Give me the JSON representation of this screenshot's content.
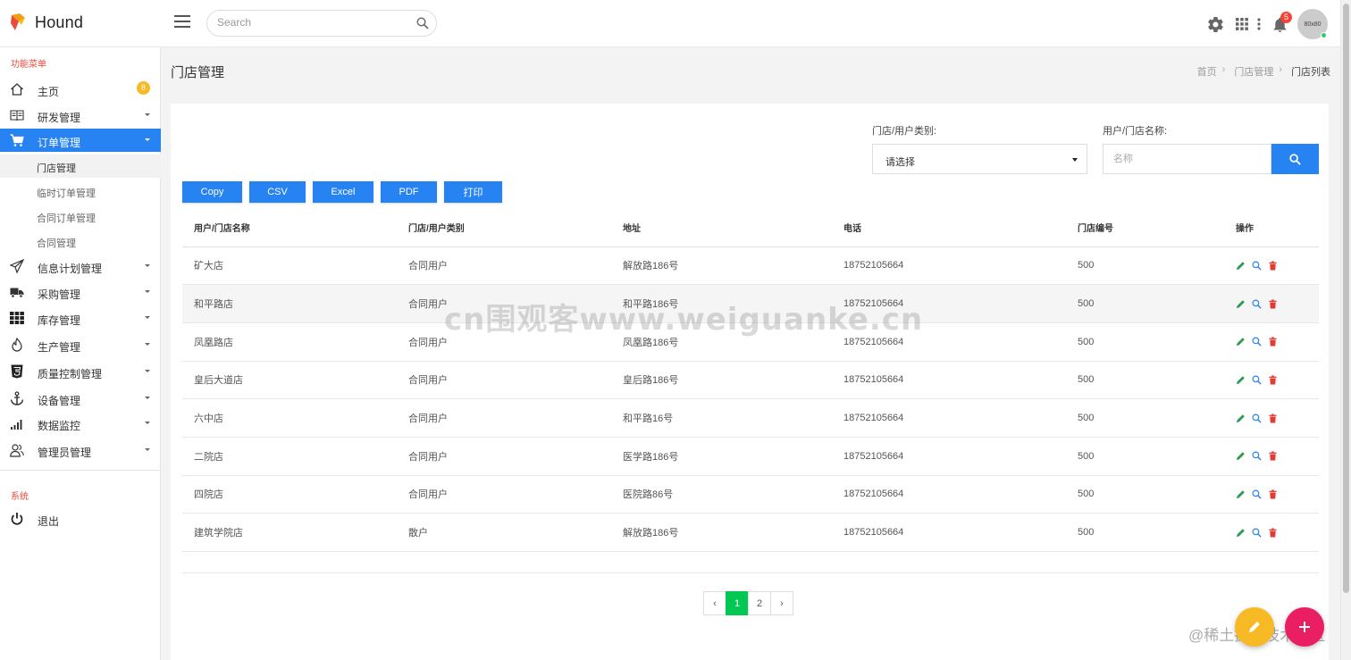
{
  "brand": {
    "name": "Hound"
  },
  "search": {
    "placeholder": "Search"
  },
  "topbar": {
    "notification_count": "5",
    "avatar_text": "80x80"
  },
  "sidebar": {
    "section_functions": "功能菜单",
    "items": [
      {
        "label": "主页",
        "icon": "home-icon",
        "badge": "8"
      },
      {
        "label": "研发管理",
        "icon": "book-icon"
      },
      {
        "label": "订单管理",
        "icon": "cart-icon",
        "active": true
      },
      {
        "label": "信息计划管理",
        "icon": "send-icon"
      },
      {
        "label": "采购管理",
        "icon": "truck-icon"
      },
      {
        "label": "库存管理",
        "icon": "grid-icon"
      },
      {
        "label": "生产管理",
        "icon": "flame-icon"
      },
      {
        "label": "质量控制管理",
        "icon": "html5-icon"
      },
      {
        "label": "设备管理",
        "icon": "anchor-icon"
      },
      {
        "label": "数据监控",
        "icon": "signal-icon"
      },
      {
        "label": "管理员管理",
        "icon": "users-icon"
      }
    ],
    "sub_items": [
      "门店管理",
      "临时订单管理",
      "合同订单管理",
      "合同管理"
    ],
    "section_system": "系统",
    "logout": "退出"
  },
  "page": {
    "title": "门店管理",
    "breadcrumb": [
      "首页",
      "门店管理",
      "门店列表"
    ]
  },
  "filters": {
    "type_label": "门店/用户类别:",
    "type_value": "请选择",
    "name_label": "用户/门店名称:",
    "name_placeholder": "名称"
  },
  "export_buttons": [
    "Copy",
    "CSV",
    "Excel",
    "PDF",
    "打印"
  ],
  "table": {
    "columns": [
      "用户/门店名称",
      "门店/用户类别",
      "地址",
      "电话",
      "门店编号",
      "操作"
    ],
    "rows": [
      [
        "矿大店",
        "合同用户",
        "解放路186号",
        "18752105664",
        "500"
      ],
      [
        "和平路店",
        "合同用户",
        "和平路186号",
        "18752105664",
        "500"
      ],
      [
        "凤凰路店",
        "合同用户",
        "凤凰路186号",
        "18752105664",
        "500"
      ],
      [
        "皇后大道店",
        "合同用户",
        "皇后路186号",
        "18752105664",
        "500"
      ],
      [
        "六中店",
        "合同用户",
        "和平路16号",
        "18752105664",
        "500"
      ],
      [
        "二院店",
        "合同用户",
        "医学路186号",
        "18752105664",
        "500"
      ],
      [
        "四院店",
        "合同用户",
        "医院路86号",
        "18752105664",
        "500"
      ],
      [
        "建筑学院店",
        "散户",
        "解放路186号",
        "18752105664",
        "500"
      ]
    ]
  },
  "pagination": {
    "prev": "‹",
    "pages": [
      "1",
      "2"
    ],
    "next": "›",
    "current": "1"
  },
  "watermarks": [
    "cn围观客www.weiguanke.cn",
    "@稀土掘金技术社区"
  ],
  "colors": {
    "primary": "#2783f2",
    "pager_active": "#00c853",
    "edit": "#2e9a4f",
    "view": "#2783f2",
    "delete": "#e53935",
    "fab_yellow": "#f7b924",
    "fab_pink": "#e91e63"
  }
}
